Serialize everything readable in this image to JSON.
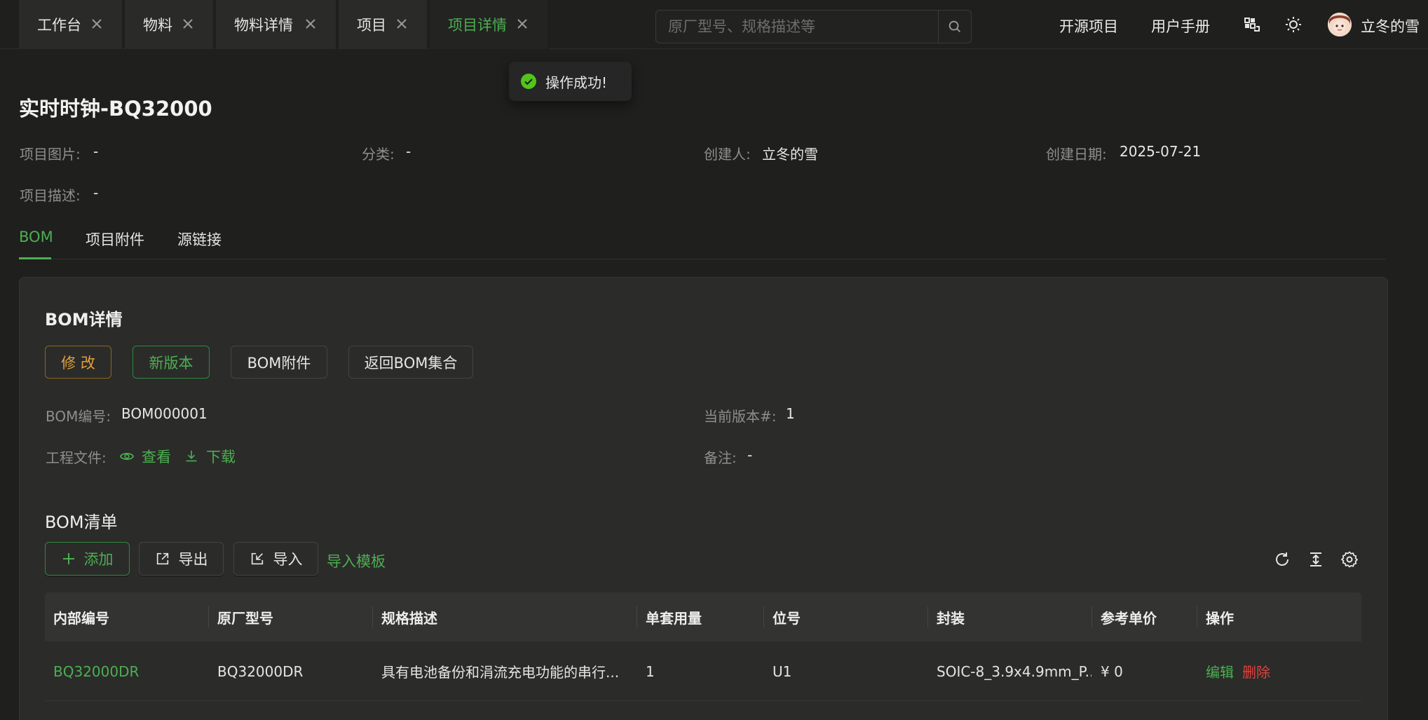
{
  "tabs": [
    {
      "label": "工作台",
      "active": false
    },
    {
      "label": "物料",
      "active": false
    },
    {
      "label": "物料详情",
      "active": false
    },
    {
      "label": "项目",
      "active": false
    },
    {
      "label": "项目详情",
      "active": true
    }
  ],
  "search": {
    "placeholder": "原厂型号、规格描述等",
    "value": ""
  },
  "topnav": {
    "open_source": "开源项目",
    "manual": "用户手册",
    "username": "立冬的雪"
  },
  "toast": {
    "text": "操作成功!"
  },
  "project": {
    "title": "实时时钟-BQ32000",
    "image_label": "项目图片:",
    "image_value": "-",
    "category_label": "分类:",
    "category_value": "-",
    "creator_label": "创建人:",
    "creator_value": "立冬的雪",
    "date_label": "创建日期:",
    "date_value": "2025-07-21",
    "desc_label": "项目描述:",
    "desc_value": "-"
  },
  "subtabs": [
    {
      "label": "BOM",
      "active": true
    },
    {
      "label": "项目附件",
      "active": false
    },
    {
      "label": "源链接",
      "active": false
    }
  ],
  "bom": {
    "title": "BOM详情",
    "buttons": {
      "edit": "修 改",
      "new_version": "新版本",
      "attachment": "BOM附件",
      "back": "返回BOM集合"
    },
    "code_label": "BOM编号:",
    "code_value": "BOM000001",
    "version_label": "当前版本#:",
    "version_value": "1",
    "file_label": "工程文件:",
    "view": "查看",
    "download": "下载",
    "note_label": "备注:",
    "note_value": "-"
  },
  "bom_list": {
    "title": "BOM清单",
    "add": "添加",
    "export": "导出",
    "import": "导入",
    "template": "导入模板",
    "columns": [
      "内部编号",
      "原厂型号",
      "规格描述",
      "单套用量",
      "位号",
      "封装",
      "参考单价",
      "操作"
    ],
    "rows": [
      {
        "code": "BQ32000DR",
        "mpn": "BQ32000DR",
        "desc": "具有电池备份和涓流充电功能的串行...",
        "qty": "1",
        "ref": "U1",
        "package": "SOIC-8_3.9x4.9mm_P...",
        "price": "¥ 0",
        "edit": "编辑",
        "delete": "删除"
      }
    ]
  },
  "colors": {
    "accent": "#4caf50",
    "warning": "#e0a23a",
    "danger": "#e0413b",
    "background": "#1f1f1e",
    "card": "#2b2b2a"
  }
}
